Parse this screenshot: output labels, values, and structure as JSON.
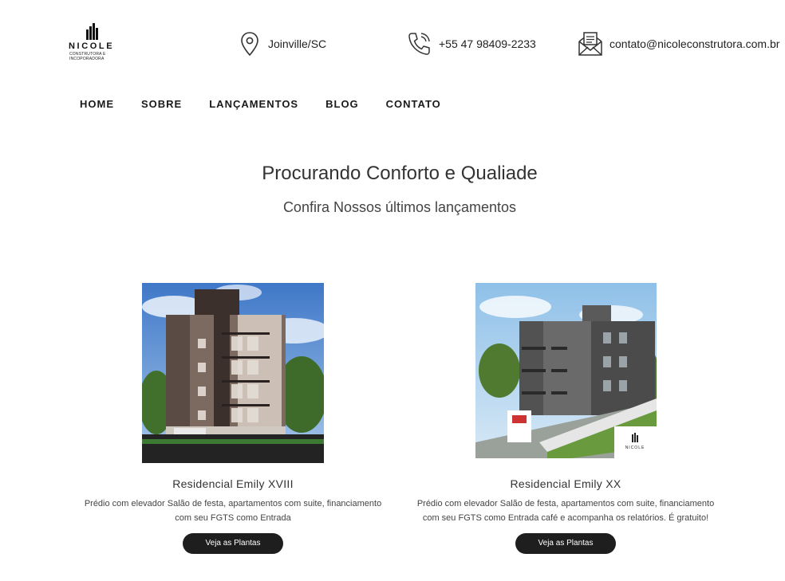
{
  "header": {
    "logo": {
      "name": "NICOLE",
      "subtitle": "CONSTRUTORA E INCOPORADORA"
    },
    "location": "Joinville/SC",
    "phone": "+55 47 98409-2233",
    "email": "contato@nicoleconstrutora.com.br"
  },
  "nav": {
    "items": [
      {
        "label": "HOME"
      },
      {
        "label": "SOBRE"
      },
      {
        "label": "LANÇAMENTOS"
      },
      {
        "label": "BLOG"
      },
      {
        "label": "CONTATO"
      }
    ]
  },
  "hero": {
    "title": "Procurando Conforto e Qualiade",
    "subtitle": "Confira Nossos últimos lançamentos"
  },
  "cards": [
    {
      "name": "Residencial Emily XVIII",
      "description": "Prédio com elevador Salão de festa, apartamentos com suite, financiamento com seu FGTS como Entrada",
      "button": "Veja as Plantas"
    },
    {
      "name": "Residencial Emily XX",
      "description": "Prédio com elevador Salão de festa, apartamentos com suite, financiamento com seu FGTS como Entrada café e acompanha os relatórios. É gratuito!",
      "button": "Veja as Plantas",
      "watermark": "NICOLE"
    }
  ],
  "colors": {
    "button_bg": "#1e1e1e",
    "text": "#2b2b2b",
    "background": "#ffffff"
  }
}
